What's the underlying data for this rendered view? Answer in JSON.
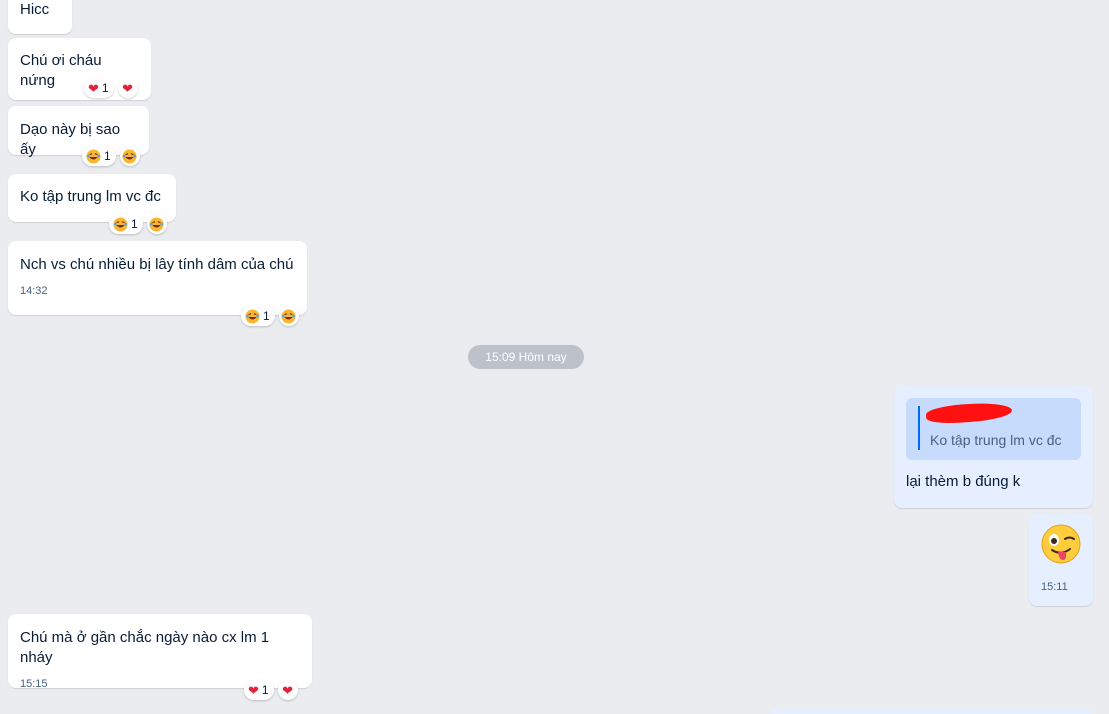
{
  "messages": {
    "m1": {
      "text": "Hicc"
    },
    "m2": {
      "text": "Chú ơi cháu nứng",
      "reaction_count": "1",
      "reaction_type": "heart"
    },
    "m3": {
      "text": "Dạo này bị sao ấy",
      "reaction_count": "1",
      "reaction_type": "laugh"
    },
    "m4": {
      "text": "Ko tập trung lm vc đc",
      "reaction_count": "1",
      "reaction_type": "laugh"
    },
    "m5": {
      "text": "Nch vs chú nhiều bị lây tính dâm của chú",
      "time": "14:32",
      "reaction_count": "1",
      "reaction_type": "laugh"
    },
    "separator": "15:09 Hôm nay",
    "m6": {
      "quote_text": "Ko tập trung lm vc đc",
      "text": "lại thèm b đúng k",
      "mine": true
    },
    "m7": {
      "emoji": "winking-face-with-tongue",
      "time": "15:11",
      "mine": true
    },
    "m8": {
      "text": "Chú mà ở gần chắc ngày nào cx lm 1 nháy",
      "time": "15:15",
      "reaction_count": "1",
      "reaction_type": "heart"
    }
  },
  "colors": {
    "background": "#ebecf0",
    "bubble_other": "#ffffff",
    "bubble_mine": "#e5efff",
    "quote_bg": "#c7dbfd",
    "accent": "#0068ff",
    "time_text": "#476285",
    "heart": "#e0243a",
    "redaction": "#ff1111"
  }
}
